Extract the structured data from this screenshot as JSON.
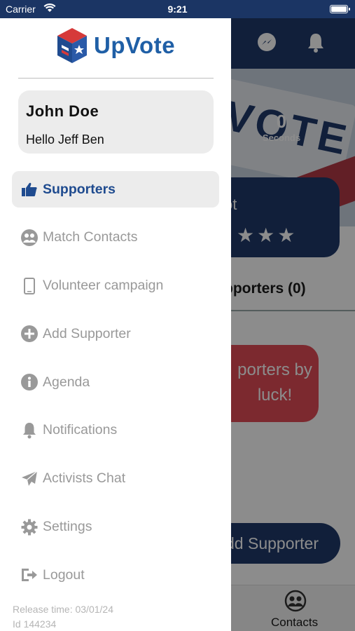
{
  "status_bar": {
    "carrier": "Carrier",
    "time": "9:21"
  },
  "background": {
    "hero": {
      "count": "0",
      "count_label": "Seconds",
      "ballot_text": "VOTE"
    },
    "card": {
      "title_partial": "ot",
      "stars": "★★★"
    },
    "tab_label": "pporters (0)",
    "luck_text": [
      "porters by",
      "luck!"
    ],
    "add_button": "dd Supporter",
    "tabbar": {
      "contacts_label": "Contacts"
    }
  },
  "drawer": {
    "logo_text": "UpVote",
    "profile": {
      "name": "John Doe",
      "greeting": "Hello Jeff Ben"
    },
    "menu": [
      {
        "label": "Supporters",
        "icon": "thumbs-up-icon",
        "active": true
      },
      {
        "label": "Match Contacts",
        "icon": "contacts-icon"
      },
      {
        "label": "Volunteer campaign",
        "icon": "phone-icon"
      },
      {
        "label": "Add Supporter",
        "icon": "plus-circle-icon"
      },
      {
        "label": "Agenda",
        "icon": "info-icon"
      },
      {
        "label": "Notifications",
        "icon": "bell-icon"
      },
      {
        "label": "Activists Chat",
        "icon": "send-icon"
      },
      {
        "label": "Settings",
        "icon": "gear-icon"
      },
      {
        "label": "Logout",
        "icon": "logout-icon"
      }
    ],
    "release_time": "Release time: 03/01/24",
    "build_id": "Id 144234"
  },
  "colors": {
    "brand_blue": "#1f4b8f",
    "header_navy": "#1f3a6b",
    "accent_red": "#e24b56",
    "inactive_gray": "#999999"
  }
}
